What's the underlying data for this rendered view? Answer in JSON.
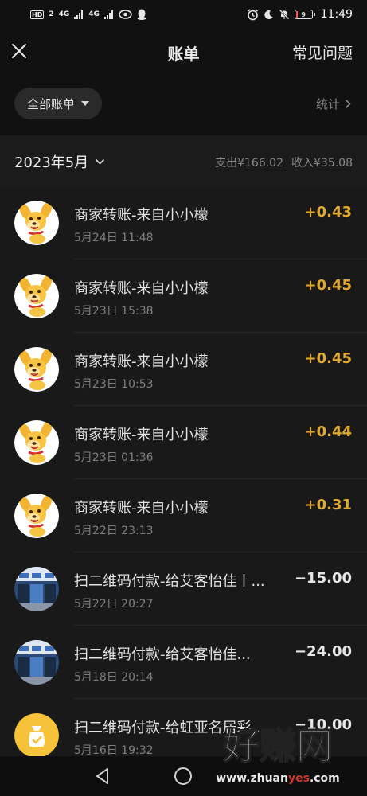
{
  "status_bar": {
    "sim1": "HD",
    "sim1_num": "2",
    "net1": "4G",
    "net2": "4G",
    "battery_level": "9",
    "time": "11:49"
  },
  "nav": {
    "close_icon": "close-icon",
    "title": "账单",
    "faq_label": "常见问题"
  },
  "filter": {
    "all_bills_label": "全部账单",
    "stats_label": "统计"
  },
  "month": {
    "label": "2023年5月",
    "expense_label": "支出",
    "expense_value": "¥166.02",
    "income_label": "收入",
    "income_value": "¥35.08"
  },
  "transactions": [
    {
      "title": "商家转账-来自小小檬",
      "time": "5月24日 11:48",
      "amount": "+0.43",
      "type": "income",
      "avatar": "dog-avatar"
    },
    {
      "title": "商家转账-来自小小檬",
      "time": "5月23日 15:38",
      "amount": "+0.45",
      "type": "income",
      "avatar": "dog-avatar"
    },
    {
      "title": "商家转账-来自小小檬",
      "time": "5月23日 10:53",
      "amount": "+0.45",
      "type": "income",
      "avatar": "dog-avatar"
    },
    {
      "title": "商家转账-来自小小檬",
      "time": "5月23日 01:36",
      "amount": "+0.44",
      "type": "income",
      "avatar": "dog-avatar"
    },
    {
      "title": "商家转账-来自小小檬",
      "time": "5月22日 23:13",
      "amount": "+0.31",
      "type": "income",
      "avatar": "dog-avatar"
    },
    {
      "title": "扫二维码付款-给艾客怡佳丨...",
      "time": "5月22日 20:27",
      "amount": "−15.00",
      "type": "expense",
      "avatar": "store-avatar"
    },
    {
      "title": "扫二维码付款-给艾客怡佳...",
      "time": "5月18日 20:14",
      "amount": "−24.00",
      "type": "expense",
      "avatar": "store-avatar"
    },
    {
      "title": "扫二维码付款-给虹亚名居彩...",
      "time": "5月16日 19:32",
      "amount": "−10.00",
      "type": "expense",
      "avatar": "money-bag-avatar"
    }
  ],
  "watermark": {
    "cn": "好赚网",
    "url_pre": "www.zhuan",
    "url_mid": "yes",
    "url_post": ".com"
  },
  "colors": {
    "income": "#e1aa2e",
    "expense": "#e6e6e6",
    "background": "#111111",
    "list_background": "#191919"
  }
}
